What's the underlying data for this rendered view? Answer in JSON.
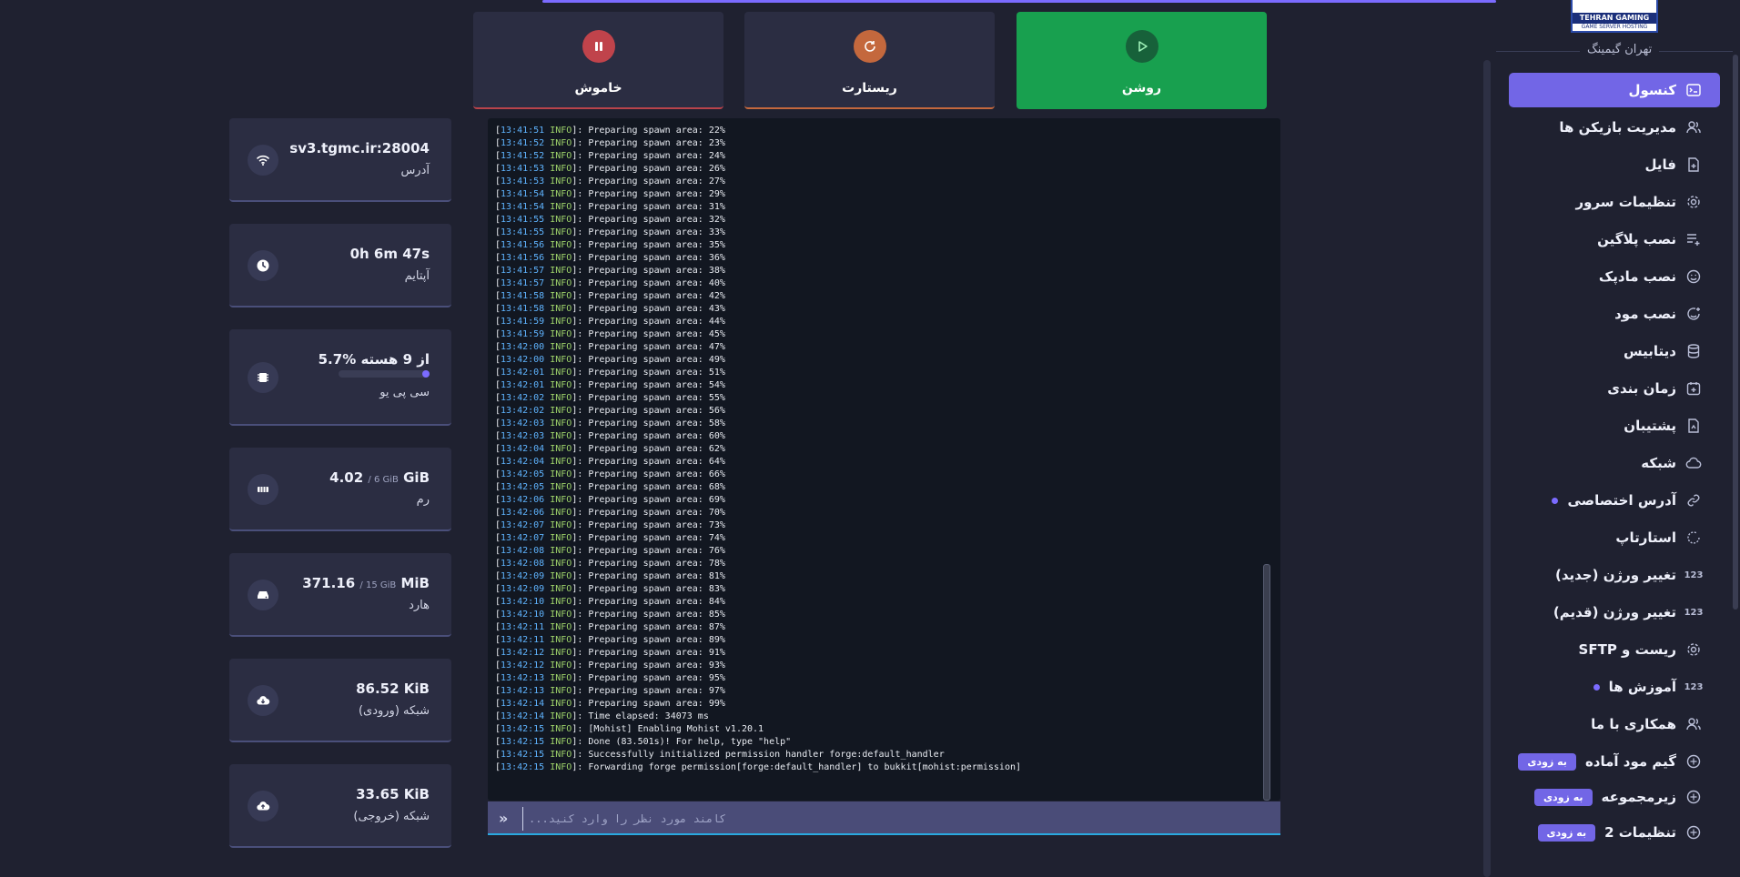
{
  "brand": {
    "logo_text": "TEHRAN GAMING",
    "logo_sub": "GAME SERVER HOSTING",
    "name": "تهران گیمینگ"
  },
  "nav": {
    "items": [
      {
        "label": "کنسول",
        "icon": "console-icon",
        "active": true
      },
      {
        "label": "مدیریت بازیکن ها",
        "icon": "users-icon"
      },
      {
        "label": "فایل",
        "icon": "file-icon"
      },
      {
        "label": "تنظیمات سرور",
        "icon": "gear-icon"
      },
      {
        "label": "نصب پلاگین",
        "icon": "list-add-icon"
      },
      {
        "label": "نصب مادپک",
        "icon": "face-icon"
      },
      {
        "label": "نصب مود",
        "icon": "face-add-icon"
      },
      {
        "label": "دیتابیس",
        "icon": "database-icon"
      },
      {
        "label": "زمان بندی",
        "icon": "calendar-icon"
      },
      {
        "label": "پشتیبان",
        "icon": "backup-icon"
      },
      {
        "label": "شبکه",
        "icon": "cloud-icon"
      },
      {
        "label": "آدرس اختصاصی",
        "icon": "link-icon",
        "dot": true
      },
      {
        "label": "استارتاپ",
        "icon": "startup-icon"
      },
      {
        "label": "تغییر ورژن (جدید)",
        "icon": "numbers-icon",
        "icon_text": "123"
      },
      {
        "label": "تغییر ورژن (قدیم)",
        "icon": "numbers-icon",
        "icon_text": "123"
      },
      {
        "label": "ریست و SFTP",
        "icon": "gear-icon"
      },
      {
        "label": "آموزش ها",
        "icon": "numbers-icon",
        "icon_text": "123",
        "dot": true
      },
      {
        "label": "همکاری با ما",
        "icon": "users-icon"
      },
      {
        "label": "گیم مود آماده",
        "icon": "wheel-icon",
        "badge": "به زودی"
      },
      {
        "label": "زیرمجموعه",
        "icon": "wheel-icon",
        "badge": "به زودی"
      },
      {
        "label": "تنظیمات 2",
        "icon": "wheel-icon",
        "badge": "به زودی"
      }
    ]
  },
  "power": {
    "stop": "خاموش",
    "restart": "ریستارت",
    "start": "روشن"
  },
  "stats": {
    "address": {
      "value": "sv3.tgmc.ir:28004",
      "label": "آدرس",
      "icon": "wifi-icon"
    },
    "uptime": {
      "value": "0h 6m 47s",
      "label": "آپتایم",
      "icon": "clock-icon"
    },
    "cpu": {
      "value": "5.7% از 9 هسته",
      "label": "سی پی یو",
      "icon": "cpu-icon",
      "percent": 5.7
    },
    "ram": {
      "value": "4.02",
      "unit": "GiB",
      "limit": "/ 6 GiB",
      "label": "رم",
      "icon": "ram-icon"
    },
    "disk": {
      "value": "371.16",
      "unit": "MiB",
      "limit": "/ 15 GiB",
      "label": "هارد",
      "icon": "disk-icon"
    },
    "net_in": {
      "value": "86.52",
      "unit": "KiB",
      "label": "شبکه (ورودی)",
      "icon": "cloud-download-icon"
    },
    "net_out": {
      "value": "33.65",
      "unit": "KiB",
      "label": "شبکه (خروجی)",
      "icon": "cloud-upload-icon"
    }
  },
  "console": {
    "placeholder": "...کامند مورد نظر را وارد کنید",
    "lines": [
      {
        "time": "13:41:51",
        "level": "INFO",
        "msg": "Preparing spawn area: 22%"
      },
      {
        "time": "13:41:52",
        "level": "INFO",
        "msg": "Preparing spawn area: 23%"
      },
      {
        "time": "13:41:52",
        "level": "INFO",
        "msg": "Preparing spawn area: 24%"
      },
      {
        "time": "13:41:53",
        "level": "INFO",
        "msg": "Preparing spawn area: 26%"
      },
      {
        "time": "13:41:53",
        "level": "INFO",
        "msg": "Preparing spawn area: 27%"
      },
      {
        "time": "13:41:54",
        "level": "INFO",
        "msg": "Preparing spawn area: 29%"
      },
      {
        "time": "13:41:54",
        "level": "INFO",
        "msg": "Preparing spawn area: 31%"
      },
      {
        "time": "13:41:55",
        "level": "INFO",
        "msg": "Preparing spawn area: 32%"
      },
      {
        "time": "13:41:55",
        "level": "INFO",
        "msg": "Preparing spawn area: 33%"
      },
      {
        "time": "13:41:56",
        "level": "INFO",
        "msg": "Preparing spawn area: 35%"
      },
      {
        "time": "13:41:56",
        "level": "INFO",
        "msg": "Preparing spawn area: 36%"
      },
      {
        "time": "13:41:57",
        "level": "INFO",
        "msg": "Preparing spawn area: 38%"
      },
      {
        "time": "13:41:57",
        "level": "INFO",
        "msg": "Preparing spawn area: 40%"
      },
      {
        "time": "13:41:58",
        "level": "INFO",
        "msg": "Preparing spawn area: 42%"
      },
      {
        "time": "13:41:58",
        "level": "INFO",
        "msg": "Preparing spawn area: 43%"
      },
      {
        "time": "13:41:59",
        "level": "INFO",
        "msg": "Preparing spawn area: 44%"
      },
      {
        "time": "13:41:59",
        "level": "INFO",
        "msg": "Preparing spawn area: 45%"
      },
      {
        "time": "13:42:00",
        "level": "INFO",
        "msg": "Preparing spawn area: 47%"
      },
      {
        "time": "13:42:00",
        "level": "INFO",
        "msg": "Preparing spawn area: 49%"
      },
      {
        "time": "13:42:01",
        "level": "INFO",
        "msg": "Preparing spawn area: 51%"
      },
      {
        "time": "13:42:01",
        "level": "INFO",
        "msg": "Preparing spawn area: 54%"
      },
      {
        "time": "13:42:02",
        "level": "INFO",
        "msg": "Preparing spawn area: 55%"
      },
      {
        "time": "13:42:02",
        "level": "INFO",
        "msg": "Preparing spawn area: 56%"
      },
      {
        "time": "13:42:03",
        "level": "INFO",
        "msg": "Preparing spawn area: 58%"
      },
      {
        "time": "13:42:03",
        "level": "INFO",
        "msg": "Preparing spawn area: 60%"
      },
      {
        "time": "13:42:04",
        "level": "INFO",
        "msg": "Preparing spawn area: 62%"
      },
      {
        "time": "13:42:04",
        "level": "INFO",
        "msg": "Preparing spawn area: 64%"
      },
      {
        "time": "13:42:05",
        "level": "INFO",
        "msg": "Preparing spawn area: 66%"
      },
      {
        "time": "13:42:05",
        "level": "INFO",
        "msg": "Preparing spawn area: 68%"
      },
      {
        "time": "13:42:06",
        "level": "INFO",
        "msg": "Preparing spawn area: 69%"
      },
      {
        "time": "13:42:06",
        "level": "INFO",
        "msg": "Preparing spawn area: 70%"
      },
      {
        "time": "13:42:07",
        "level": "INFO",
        "msg": "Preparing spawn area: 73%"
      },
      {
        "time": "13:42:07",
        "level": "INFO",
        "msg": "Preparing spawn area: 74%"
      },
      {
        "time": "13:42:08",
        "level": "INFO",
        "msg": "Preparing spawn area: 76%"
      },
      {
        "time": "13:42:08",
        "level": "INFO",
        "msg": "Preparing spawn area: 78%"
      },
      {
        "time": "13:42:09",
        "level": "INFO",
        "msg": "Preparing spawn area: 81%"
      },
      {
        "time": "13:42:09",
        "level": "INFO",
        "msg": "Preparing spawn area: 83%"
      },
      {
        "time": "13:42:10",
        "level": "INFO",
        "msg": "Preparing spawn area: 84%"
      },
      {
        "time": "13:42:10",
        "level": "INFO",
        "msg": "Preparing spawn area: 85%"
      },
      {
        "time": "13:42:11",
        "level": "INFO",
        "msg": "Preparing spawn area: 87%"
      },
      {
        "time": "13:42:11",
        "level": "INFO",
        "msg": "Preparing spawn area: 89%"
      },
      {
        "time": "13:42:12",
        "level": "INFO",
        "msg": "Preparing spawn area: 91%"
      },
      {
        "time": "13:42:12",
        "level": "INFO",
        "msg": "Preparing spawn area: 93%"
      },
      {
        "time": "13:42:13",
        "level": "INFO",
        "msg": "Preparing spawn area: 95%"
      },
      {
        "time": "13:42:13",
        "level": "INFO",
        "msg": "Preparing spawn area: 97%"
      },
      {
        "time": "13:42:14",
        "level": "INFO",
        "msg": "Preparing spawn area: 99%"
      },
      {
        "time": "13:42:14",
        "level": "INFO",
        "msg": "Time elapsed: 34073 ms"
      },
      {
        "time": "13:42:15",
        "level": "INFO",
        "msg": "[Mohist] Enabling Mohist v1.20.1"
      },
      {
        "time": "13:42:15",
        "level": "INFO",
        "msg": "Done (83.501s)! For help, type \"help\""
      },
      {
        "time": "13:42:15",
        "level": "INFO",
        "msg": "Successfully initialized permission handler forge:default_handler"
      },
      {
        "time": "13:42:15",
        "level": "INFO",
        "msg": "Forwarding forge permission[forge:default_handler] to bukkit[mohist:permission]"
      }
    ]
  },
  "colors": {
    "accent": "#7266e6",
    "start": "#18a04f",
    "stop": "#c0434b",
    "restart": "#c4683d",
    "timestamp": "#5fb4ff",
    "info": "#9ed36a"
  }
}
